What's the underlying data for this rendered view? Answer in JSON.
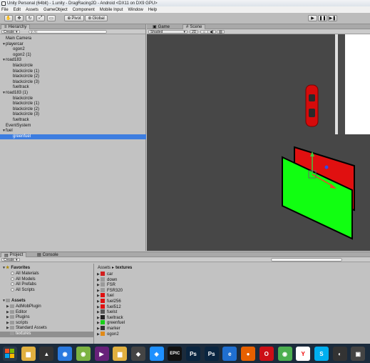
{
  "window": {
    "title": "Unity Personal (64bit) - 1.unity - DragRacing2D - Android <DX11 on DX9 GPU>"
  },
  "menu": [
    "File",
    "Edit",
    "Assets",
    "GameObject",
    "Component",
    "Mobile Input",
    "Window",
    "Help"
  ],
  "toolbar": {
    "pivot": "Pivot",
    "global": "Global"
  },
  "hierarchy": {
    "tab": "Hierarchy",
    "create": "Create",
    "search_placeholder": "All",
    "items": [
      {
        "label": "Main Camera",
        "indent": 0,
        "arrow": ""
      },
      {
        "label": "playercar",
        "indent": 0,
        "arrow": "down"
      },
      {
        "label": "ogon2",
        "indent": 1,
        "arrow": ""
      },
      {
        "label": "ogon2 (1)",
        "indent": 1,
        "arrow": ""
      },
      {
        "label": "road183",
        "indent": 0,
        "arrow": "down"
      },
      {
        "label": "blackcircle",
        "indent": 1,
        "arrow": ""
      },
      {
        "label": "blackcircle (1)",
        "indent": 1,
        "arrow": ""
      },
      {
        "label": "blackcircle (2)",
        "indent": 1,
        "arrow": ""
      },
      {
        "label": "blackcircle (3)",
        "indent": 1,
        "arrow": ""
      },
      {
        "label": "fueltrack",
        "indent": 1,
        "arrow": ""
      },
      {
        "label": "road183 (1)",
        "indent": 0,
        "arrow": "down"
      },
      {
        "label": "blackcircle",
        "indent": 1,
        "arrow": ""
      },
      {
        "label": "blackcircle (1)",
        "indent": 1,
        "arrow": ""
      },
      {
        "label": "blackcircle (2)",
        "indent": 1,
        "arrow": ""
      },
      {
        "label": "blackcircle (3)",
        "indent": 1,
        "arrow": ""
      },
      {
        "label": "fueltrack",
        "indent": 1,
        "arrow": ""
      },
      {
        "label": "EventSystem",
        "indent": 0,
        "arrow": ""
      },
      {
        "label": "fuel",
        "indent": 0,
        "arrow": "down"
      },
      {
        "label": "greenfuel",
        "indent": 1,
        "arrow": "",
        "selected": true
      }
    ]
  },
  "scene": {
    "tab_game": "Game",
    "tab_scene": "Scene",
    "shading": "Shaded",
    "mode_2d": "2D"
  },
  "project": {
    "tab_project": "Project",
    "tab_console": "Console",
    "create": "Create",
    "favorites_label": "Favorites",
    "favorites": [
      "All Materials",
      "All Models",
      "All Prefabs",
      "All Scripts"
    ],
    "assets_label": "Assets",
    "folders": [
      "AdMobPlugin",
      "Editor",
      "Plugins",
      "scripts",
      "Standard Assets",
      "textures"
    ],
    "breadcrumb_root": "Assets",
    "breadcrumb_sep": "▸",
    "breadcrumb_current": "textures",
    "files": [
      {
        "label": "car",
        "color": "#d21e1e"
      },
      {
        "label": "down",
        "color": "#9a9a9a"
      },
      {
        "label": "FSR",
        "color": "#9a9a9a"
      },
      {
        "label": "FSR320",
        "color": "#9a9a9a"
      },
      {
        "label": "fuel",
        "color": "#e01010"
      },
      {
        "label": "fuel256",
        "color": "#e01010"
      },
      {
        "label": "fuel512",
        "color": "#e01010"
      },
      {
        "label": "fuelst",
        "color": "#555555"
      },
      {
        "label": "fueltrack",
        "color": "#222222"
      },
      {
        "label": "greenfuel",
        "color": "#18d018"
      },
      {
        "label": "marker",
        "color": "#333333"
      },
      {
        "label": "ogon2",
        "color": "#e08a18"
      }
    ]
  },
  "taskbar": {
    "icons": [
      {
        "name": "start-icon",
        "glyph": "",
        "color": "#2b3a4a"
      },
      {
        "name": "folder-icon",
        "glyph": "▆",
        "color": "#e0b040"
      },
      {
        "name": "app-icon",
        "glyph": "▲",
        "color": "#333333"
      },
      {
        "name": "ie-like-icon",
        "glyph": "◉",
        "color": "#2a7ae0"
      },
      {
        "name": "android-icon",
        "glyph": "◉",
        "color": "#7cb342"
      },
      {
        "name": "visual-studio-icon",
        "glyph": "▶",
        "color": "#68217a"
      },
      {
        "name": "folder2-icon",
        "glyph": "▆",
        "color": "#e0b040"
      },
      {
        "name": "unity-icon",
        "glyph": "◆",
        "color": "#444444"
      },
      {
        "name": "web-icon",
        "glyph": "◈",
        "color": "#1e90ff"
      },
      {
        "name": "epic-icon",
        "glyph": "EPIC",
        "color": "#111111"
      },
      {
        "name": "photoshop-icon",
        "glyph": "Ps",
        "color": "#0a2540"
      },
      {
        "name": "photoshop2-icon",
        "glyph": "Ps",
        "color": "#0a2540"
      },
      {
        "name": "internet-explorer-icon",
        "glyph": "e",
        "color": "#1f6fd0"
      },
      {
        "name": "firefox-icon",
        "glyph": "●",
        "color": "#e66000"
      },
      {
        "name": "opera-icon",
        "glyph": "O",
        "color": "#cc0f16"
      },
      {
        "name": "chrome-icon",
        "glyph": "◉",
        "color": "#4caf50"
      },
      {
        "name": "yandex-icon",
        "glyph": "Y",
        "color": "#ffffff"
      },
      {
        "name": "skype-icon",
        "glyph": "S",
        "color": "#00aff0"
      },
      {
        "name": "media-icon",
        "glyph": "◐",
        "color": "#333333"
      },
      {
        "name": "app2-icon",
        "glyph": "▣",
        "color": "#444444"
      }
    ]
  }
}
